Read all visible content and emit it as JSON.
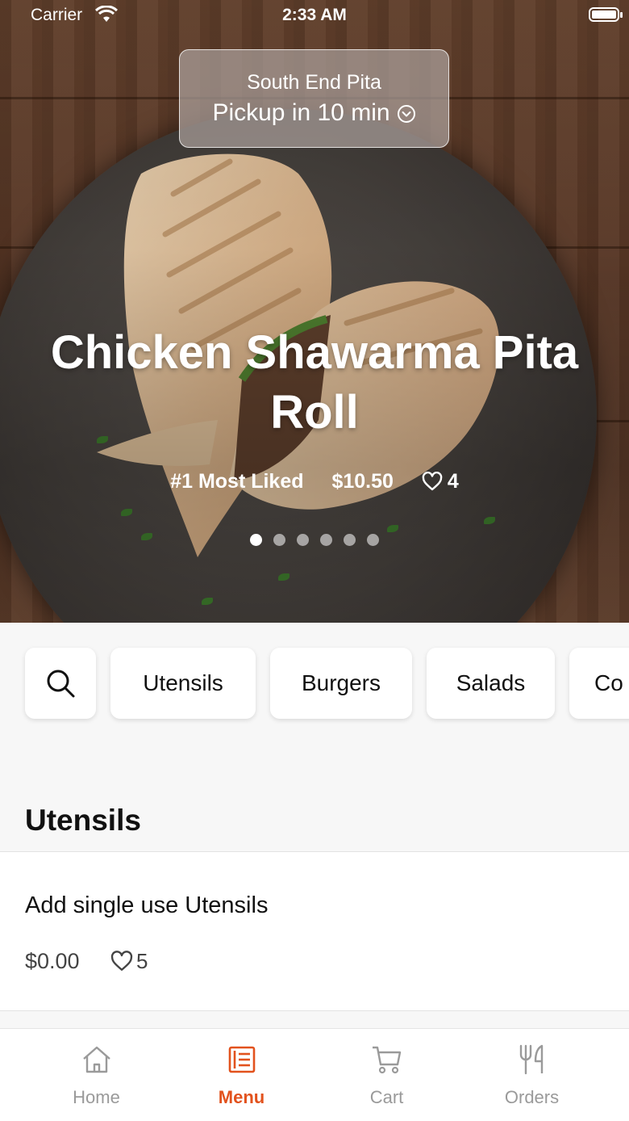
{
  "status_bar": {
    "carrier": "Carrier",
    "time": "2:33 AM"
  },
  "pickup": {
    "store": "South End Pita",
    "pickup_text": "Pickup in 10 min"
  },
  "featured": {
    "title": "Chicken Shawarma Pita Roll",
    "badge": "#1 Most Liked",
    "price": "$10.50",
    "likes": "4",
    "carousel_count": 6,
    "carousel_active": 0
  },
  "categories": [
    "search-icon",
    "Utensils",
    "Burgers",
    "Salads",
    "Co"
  ],
  "section": {
    "title": "Utensils"
  },
  "items": [
    {
      "name": "Add single use Utensils",
      "price": "$0.00",
      "likes": "5"
    }
  ],
  "tabs": [
    {
      "label": "Home",
      "icon": "home-icon",
      "active": false
    },
    {
      "label": "Menu",
      "icon": "menu-icon",
      "active": true
    },
    {
      "label": "Cart",
      "icon": "cart-icon",
      "active": false
    },
    {
      "label": "Orders",
      "icon": "utensils-icon",
      "active": false
    }
  ],
  "colors": {
    "accent": "#e2521d",
    "tab_inactive": "#9a9a9a"
  }
}
